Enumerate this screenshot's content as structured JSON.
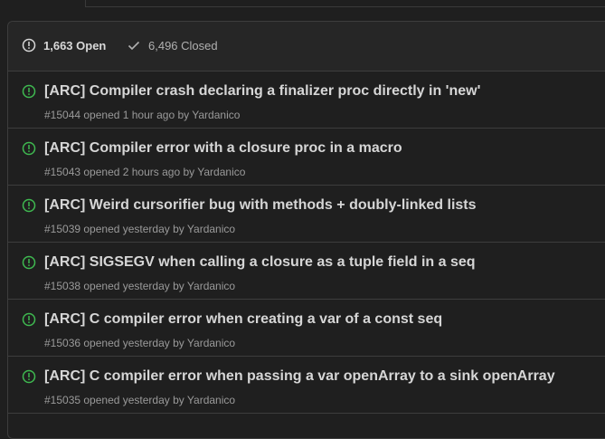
{
  "header": {
    "open_count": "1,663 Open",
    "closed_count": "6,496 Closed"
  },
  "colors": {
    "open_icon": "#3fb950",
    "title_text": "#d6d6d6",
    "meta_text": "#9a9a9a"
  },
  "issues": [
    {
      "title": "[ARC] Compiler crash declaring a finalizer proc directly in 'new'",
      "meta": "#15044 opened 1 hour ago by Yardanico",
      "icon": "issue-opened-icon"
    },
    {
      "title": "[ARC] Compiler error with a closure proc in a macro",
      "meta": "#15043 opened 2 hours ago by Yardanico",
      "icon": "issue-opened-icon"
    },
    {
      "title": "[ARC] Weird cursorifier bug with methods + doubly-linked lists",
      "meta": "#15039 opened yesterday by Yardanico",
      "icon": "issue-opened-icon"
    },
    {
      "title": "[ARC] SIGSEGV when calling a closure as a tuple field in a seq",
      "meta": "#15038 opened yesterday by Yardanico",
      "icon": "issue-opened-icon"
    },
    {
      "title": "[ARC] C compiler error when creating a var of a const seq",
      "meta": "#15036 opened yesterday by Yardanico",
      "icon": "issue-opened-icon"
    },
    {
      "title": "[ARC] C compiler error when passing a var openArray to a sink openArray",
      "meta": "#15035 opened yesterday by Yardanico",
      "icon": "issue-opened-icon"
    }
  ]
}
